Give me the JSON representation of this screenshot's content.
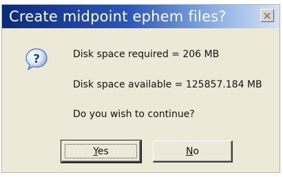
{
  "dialog": {
    "title": "Create midpoint ephem files?",
    "icon": "question-icon",
    "messages": [
      "Disk space required = 206 MB",
      "Disk space available = 125857.184 MB",
      "Do you wish to continue?"
    ],
    "buttons": {
      "yes": {
        "mnemonic": "Y",
        "rest": "es"
      },
      "no": {
        "mnemonic": "N",
        "rest": "o"
      }
    }
  },
  "colors": {
    "titlebar_start": "#0b2a7a",
    "titlebar_end": "#d6e2f4",
    "dialog_bg": "#ece9d8"
  }
}
